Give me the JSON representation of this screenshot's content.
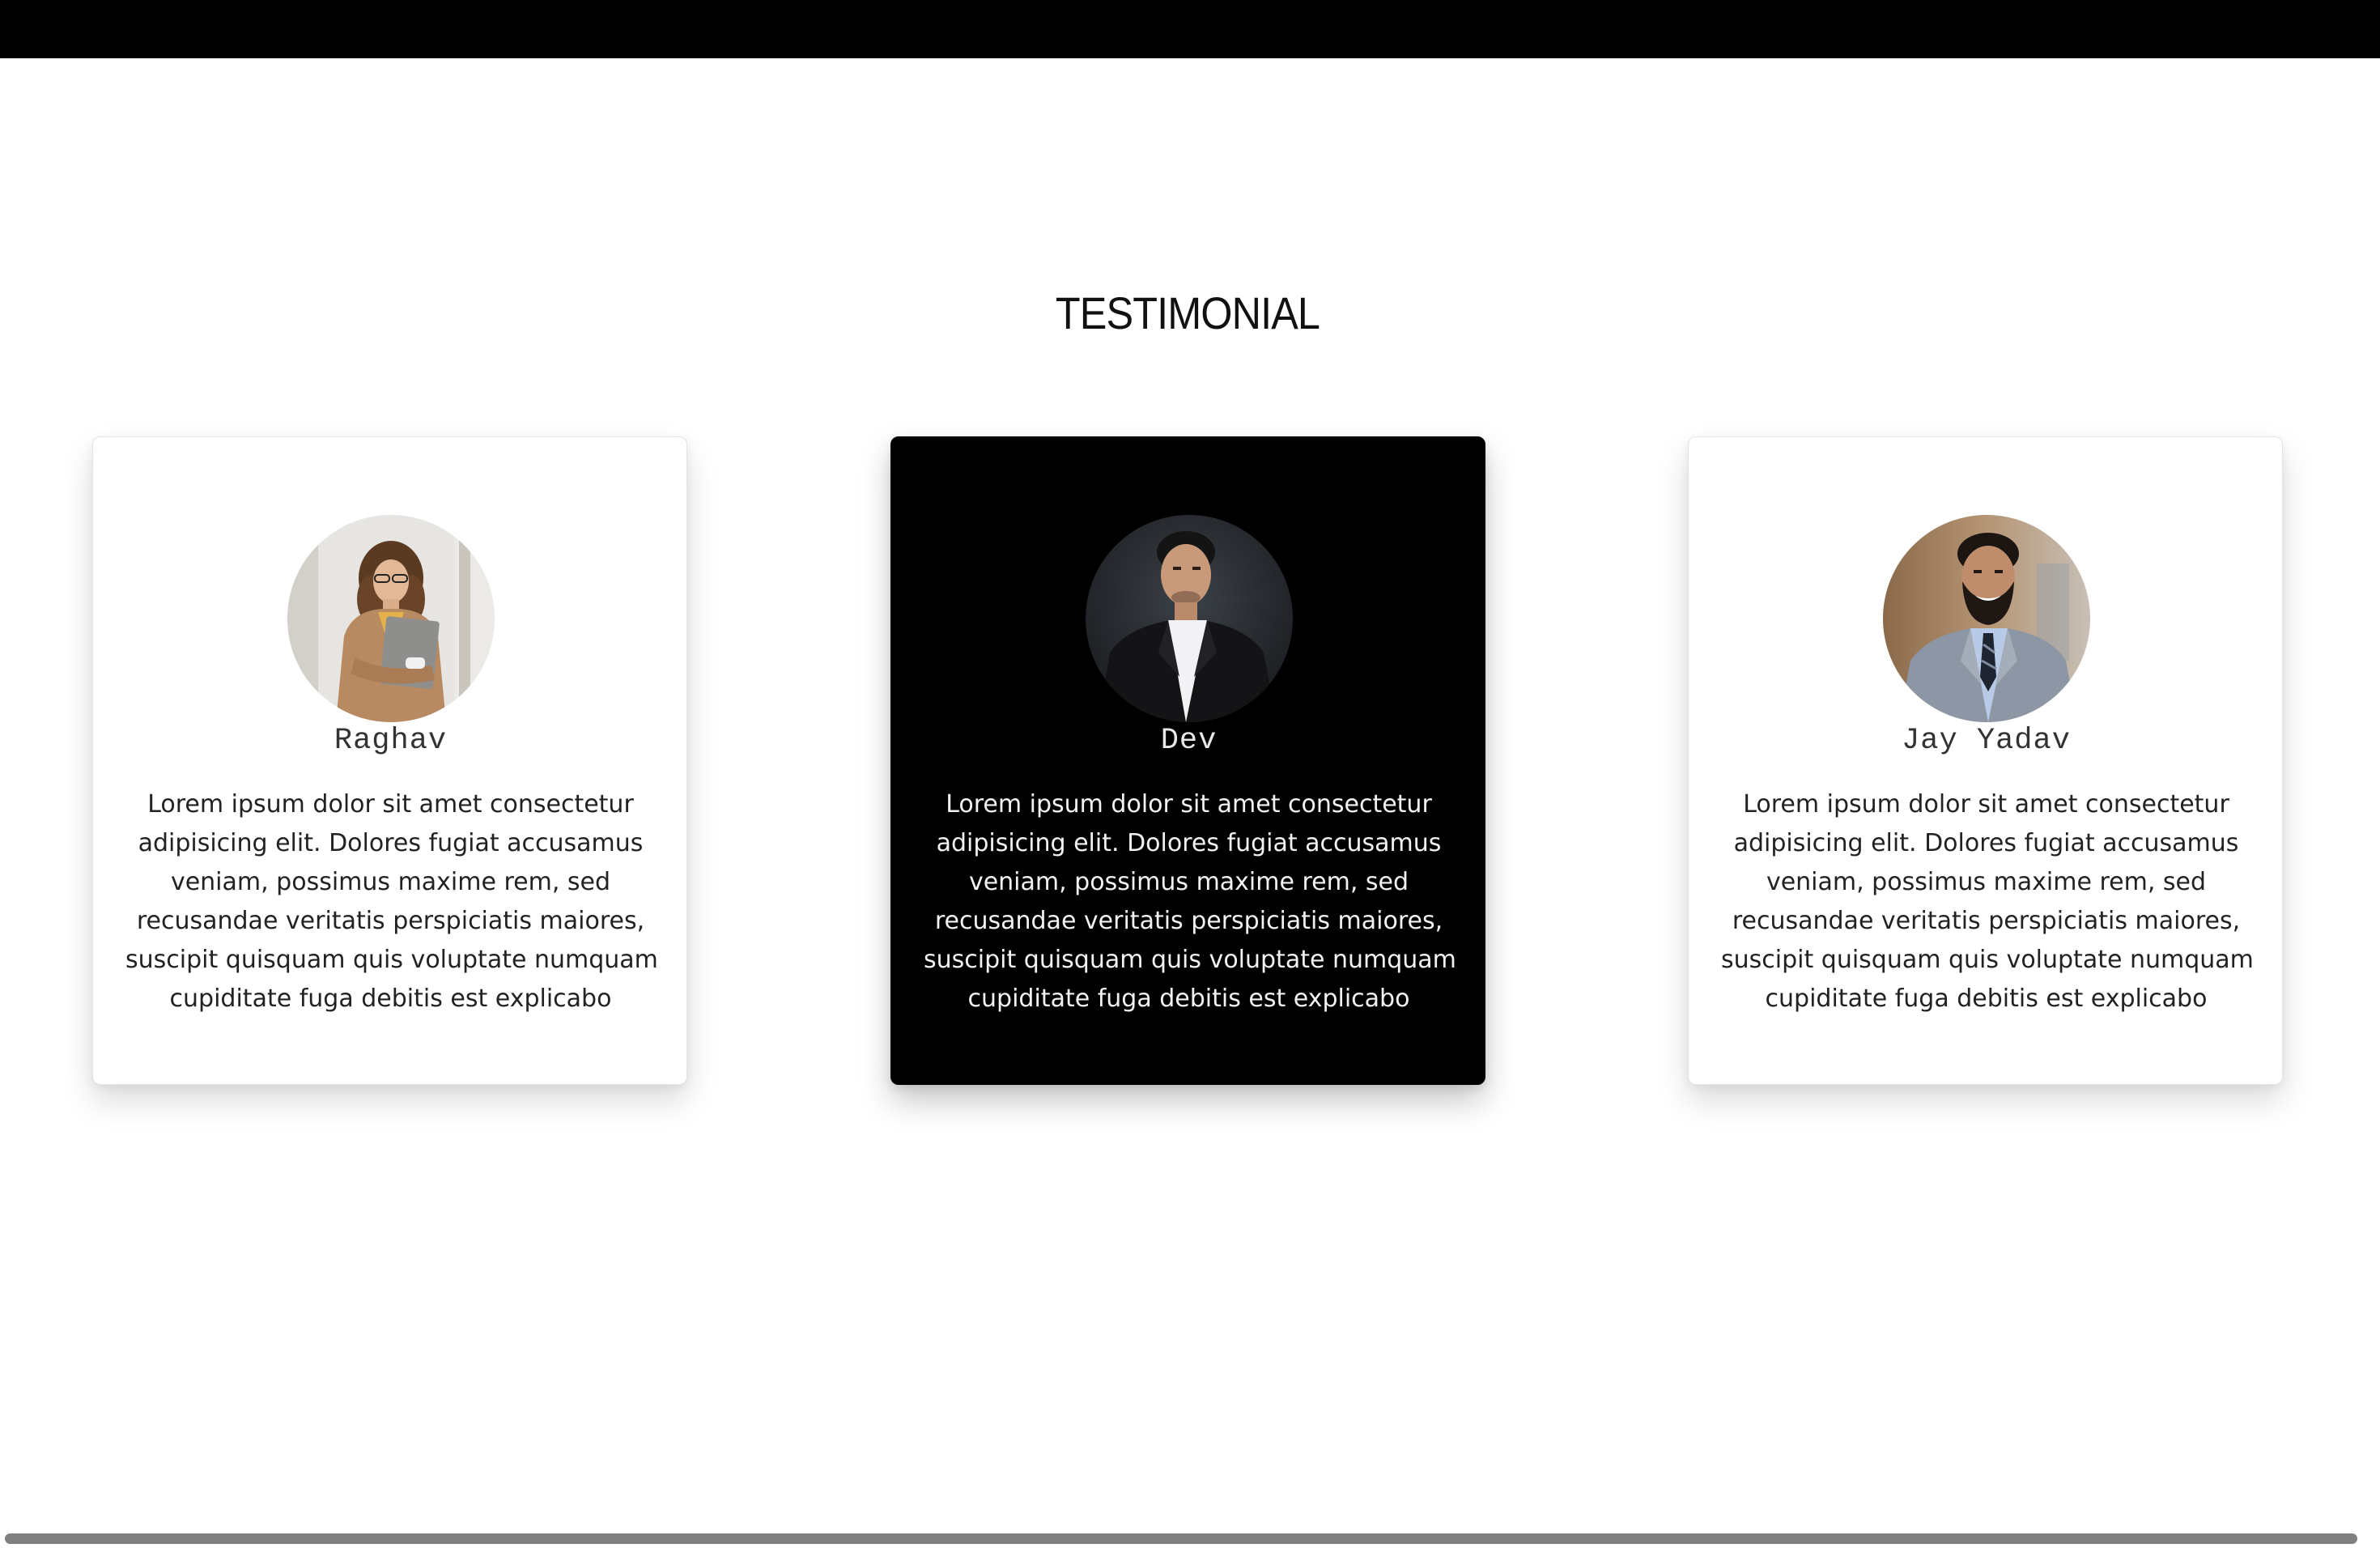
{
  "section": {
    "title": "TESTIMONIAL"
  },
  "testimonials": [
    {
      "name": "Raghav",
      "avatar_icon": "woman-holding-laptop-avatar",
      "text_lines": [
        "Lorem ipsum dolor sit amet consectetur",
        "adipisicing elit. Dolores fugiat accusamus",
        "veniam, possimus maxime rem, sed",
        "recusandae veritatis perspiciatis maiores,",
        "suscipit quisquam quis voluptate numquam",
        "cupiditate fuga debitis est explicabo"
      ]
    },
    {
      "name": "Dev",
      "avatar_icon": "man-in-suit-avatar",
      "text_lines": [
        "Lorem ipsum dolor sit amet consectetur",
        "adipisicing elit. Dolores fugiat accusamus",
        "veniam, possimus maxime rem, sed",
        "recusandae veritatis perspiciatis maiores,",
        "suscipit quisquam quis voluptate numquam",
        "cupiditate fuga debitis est explicabo"
      ]
    },
    {
      "name": "Jay Yadav",
      "avatar_icon": "smiling-bearded-man-avatar",
      "text_lines": [
        "Lorem ipsum dolor sit amet consectetur",
        "adipisicing elit. Dolores fugiat accusamus",
        "veniam, possimus maxime rem, sed",
        "recusandae veritatis perspiciatis maiores,",
        "suscipit quisquam quis voluptate numquam",
        "cupiditate fuga debitis est explicabo"
      ]
    }
  ],
  "colors": {
    "header_bar": "#000000",
    "highlight_card_bg": "#000000",
    "card_bg": "#ffffff",
    "scrollbar_thumb": "#808080"
  }
}
